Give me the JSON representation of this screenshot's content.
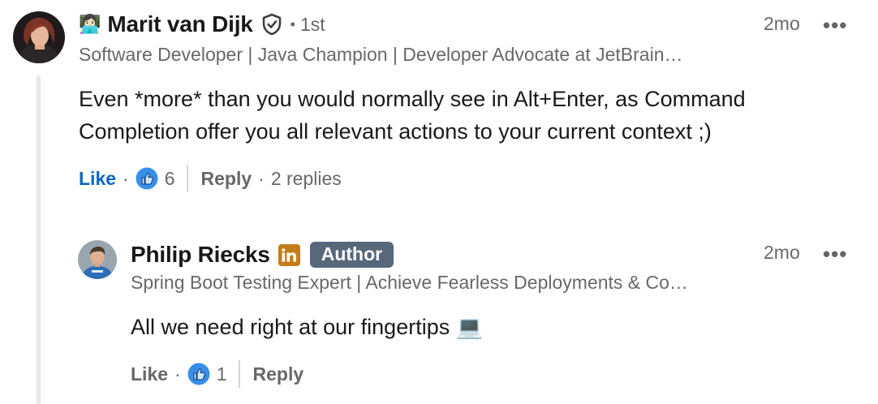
{
  "comment": {
    "author_emoji": "👩🏻‍💻",
    "author_name": "Marit van Dijk",
    "degree_dot": "•",
    "degree": "1st",
    "headline": "Software Developer | Java Champion | Developer Advocate at JetBrain…",
    "timestamp": "2mo",
    "more": "•••",
    "text_line1": "Even *more* than you would normally see in Alt+Enter, as Command",
    "text_line2": "Completion offer you all relevant actions to your current context ;)",
    "like_label": "Like",
    "like_dot": "·",
    "reaction_count": "6",
    "reply_label": "Reply",
    "reply_dot": "·",
    "replies_count": "2 replies"
  },
  "reply": {
    "author_name": "Philip Riecks",
    "author_badge": "Author",
    "headline": "Spring Boot Testing Expert | Achieve Fearless Deployments & Co…",
    "timestamp": "2mo",
    "more": "•••",
    "text": "All we need right at our fingertips 💻",
    "like_label": "Like",
    "like_dot": "·",
    "reaction_count": "1",
    "reply_label": "Reply"
  },
  "colors": {
    "link_blue": "#0a66c2",
    "like_icon_blue": "#378fe9",
    "badge_gray": "#56687a",
    "influencer_gold": "#c37d16",
    "thread_line": "#e8e8e6"
  },
  "icons": {
    "verified": "shield-check-icon",
    "like_reaction": "thumbs-up-reaction-icon",
    "linkedin_influencer": "linkedin-in-icon"
  }
}
